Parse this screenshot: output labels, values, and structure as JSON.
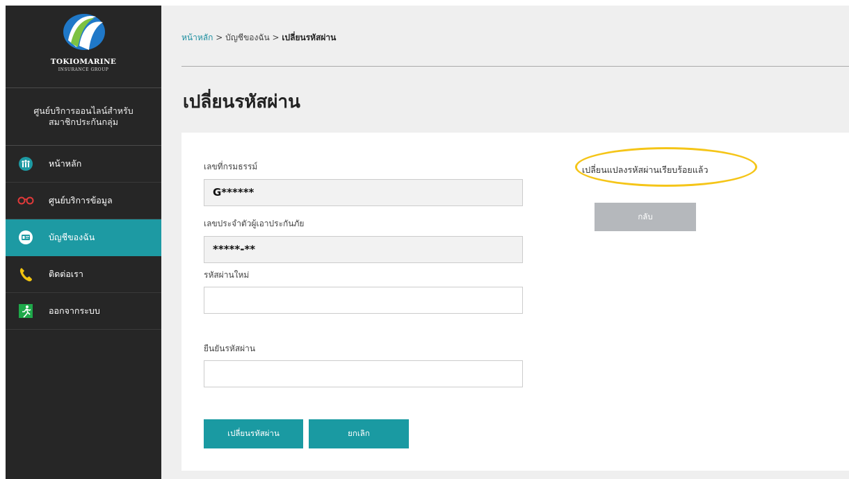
{
  "brand": {
    "name": "TOKIOMARINE",
    "group": "INSURANCE GROUP"
  },
  "sidebar": {
    "center_title_line1": "ศูนย์บริการออนไลน์สำหรับ",
    "center_title_line2": "สมาชิกประกันกลุ่ม",
    "items": [
      {
        "label": "หน้าหลัก",
        "icon": "people-icon"
      },
      {
        "label": "ศูนย์บริการข้อมูล",
        "icon": "glasses-icon"
      },
      {
        "label": "บัญชีของฉัน",
        "icon": "id-card-icon",
        "active": true
      },
      {
        "label": "ติดต่อเรา",
        "icon": "phone-icon"
      },
      {
        "label": "ออกจากระบบ",
        "icon": "exit-icon"
      }
    ]
  },
  "breadcrumb": {
    "home": "หน้าหลัก",
    "sep": " > ",
    "account": "บัญชีของฉัน",
    "current": "เปลี่ยนรหัสผ่าน"
  },
  "page_title": "เปลี่ยนรหัสผ่าน",
  "form": {
    "policy_label": "เลขที่กรมธรรม์",
    "policy_value": "G******",
    "insured_label": "เลขประจำตัวผู้เอาประกันภัย",
    "insured_value": "*****-**",
    "new_password_label": "รหัสผ่านใหม่",
    "confirm_password_label": "ยืนยันรหัสผ่าน",
    "submit_label": "เปลี่ยนรหัสผ่าน",
    "cancel_label": "ยกเลิก"
  },
  "result": {
    "message": "เปลี่ยนแปลงรหัสผ่านเรียบร้อยแล้ว",
    "back_label": "กลับ",
    "highlight_color": "#f5c518"
  },
  "colors": {
    "accent": "#1a9aa2",
    "sidebar_bg": "#262626"
  }
}
